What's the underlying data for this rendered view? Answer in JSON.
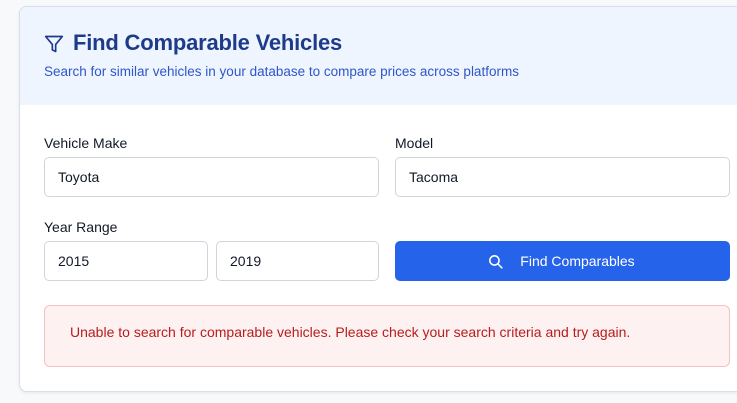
{
  "header": {
    "title": "Find Comparable Vehicles",
    "subtitle": "Search for similar vehicles in your database to compare prices across platforms",
    "icon": "filter-icon"
  },
  "form": {
    "make": {
      "label": "Vehicle Make",
      "value": "Toyota"
    },
    "model": {
      "label": "Model",
      "value": "Tacoma"
    },
    "year_range": {
      "label": "Year Range",
      "from": "2015",
      "to": "2019"
    },
    "submit": {
      "label": "Find Comparables",
      "icon": "search-icon"
    }
  },
  "error": {
    "message": "Unable to search for comparable vehicles. Please check your search criteria and try again."
  },
  "colors": {
    "accent": "#2563eb",
    "title": "#1e3a8a",
    "header_bg": "#eff5ff",
    "error_text": "#b91c1c",
    "error_bg": "#fdf1f1"
  }
}
